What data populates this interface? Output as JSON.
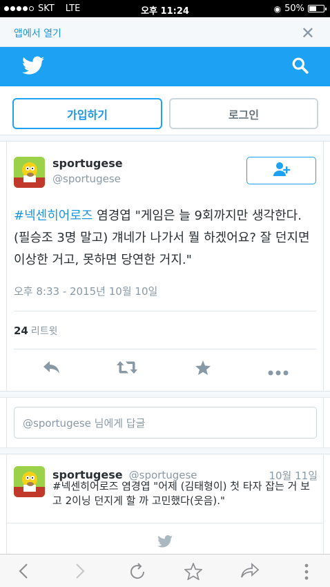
{
  "status_bar": {
    "carrier": "SKT",
    "network": "LTE",
    "time": "오후 11:24",
    "battery": "50%",
    "battery_level": 0.5
  },
  "app_banner": {
    "label": "앱에서 열기",
    "close_icon": "close-icon"
  },
  "header": {
    "logo_icon": "twitter-bird-icon",
    "search_icon": "search-icon",
    "brand_color": "#1da1f2"
  },
  "auth": {
    "signup_label": "가입하기",
    "login_label": "로그인"
  },
  "tweet": {
    "name": "sportugese",
    "handle": "@sportugese",
    "hashtag": "#넥센히어로즈",
    "text": " 염경엽 \"게임은 늘 9회까지만 생각한다. (필승조 3명 말고) 걔네가 나가서 뭘 하겠어요? 잘 던지면 이상한 거고, 못하면 당연한 거지.\"",
    "timestamp": "오후 8:33 - 2015년 10월 10일",
    "retweet_count": "24",
    "retweet_label": "리트윗",
    "follow_icon": "add-user-icon",
    "actions": [
      "reply-icon",
      "retweet-icon",
      "favorite-icon",
      "more-icon"
    ]
  },
  "reply": {
    "handle": "@sportugese",
    "suffix": " 님에게 답글"
  },
  "tweet2": {
    "name": "sportugese",
    "handle": "@sportugese",
    "date": "10월 11일",
    "text": "#넥센히어로즈 염경엽 \"어제 (김태형이) 첫 타자 잡는 거 보고 2이닝 던지게 할 까 고민했다(웃음).\""
  },
  "safari_toolbar": [
    "back-icon",
    "forward-icon",
    "reload-icon",
    "bookmark-star-icon",
    "share-icon",
    "menu-dots-icon"
  ]
}
